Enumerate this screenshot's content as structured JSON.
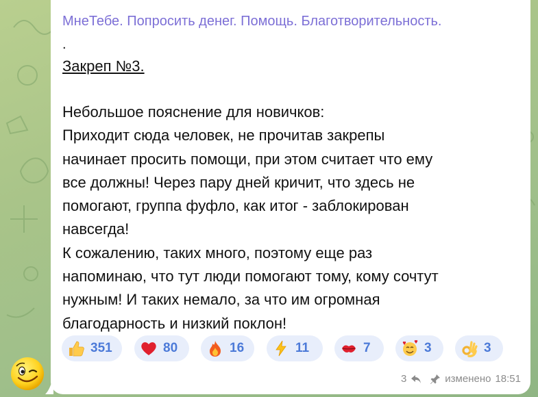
{
  "message": {
    "sender": "МнеТебе. Попросить денег. Помощь. Благотворительность.",
    "dot": ".",
    "pin_title": "Закреп №3.",
    "body_lines": [
      "Небольшое пояснение для новичков:",
      "Приходит сюда человек, не прочитав закрепы",
      "начинает просить помощи, при этом считает что ему",
      "все должны! Через пару дней кричит, что здесь не",
      "помогают, группа фуфло, как итог - заблокирован",
      "навсегда!",
      "К сожалению, таких много, поэтому еще раз",
      "напоминаю, что тут люди помогают тому, кому сочтут",
      "нужным! И таких немало, за что им огромная",
      "благодарность и низкий поклон!"
    ],
    "reactions": [
      {
        "icon": "thumbs-up-icon",
        "count": "351"
      },
      {
        "icon": "red-heart-icon",
        "count": "80"
      },
      {
        "icon": "fire-icon",
        "count": "16"
      },
      {
        "icon": "lightning-icon",
        "count": "11"
      },
      {
        "icon": "kiss-mark-icon",
        "count": "7"
      },
      {
        "icon": "smiling-face-with-hearts-icon",
        "count": "3"
      },
      {
        "icon": "ok-hand-icon",
        "count": "3"
      }
    ],
    "replies_count": "3",
    "edited_label": "изменено",
    "time": "18:51"
  },
  "colors": {
    "sender": "#7c6fd6",
    "reaction_bg": "#e8eefb",
    "reaction_count": "#4c7ad8",
    "meta": "#8b8b8b"
  }
}
